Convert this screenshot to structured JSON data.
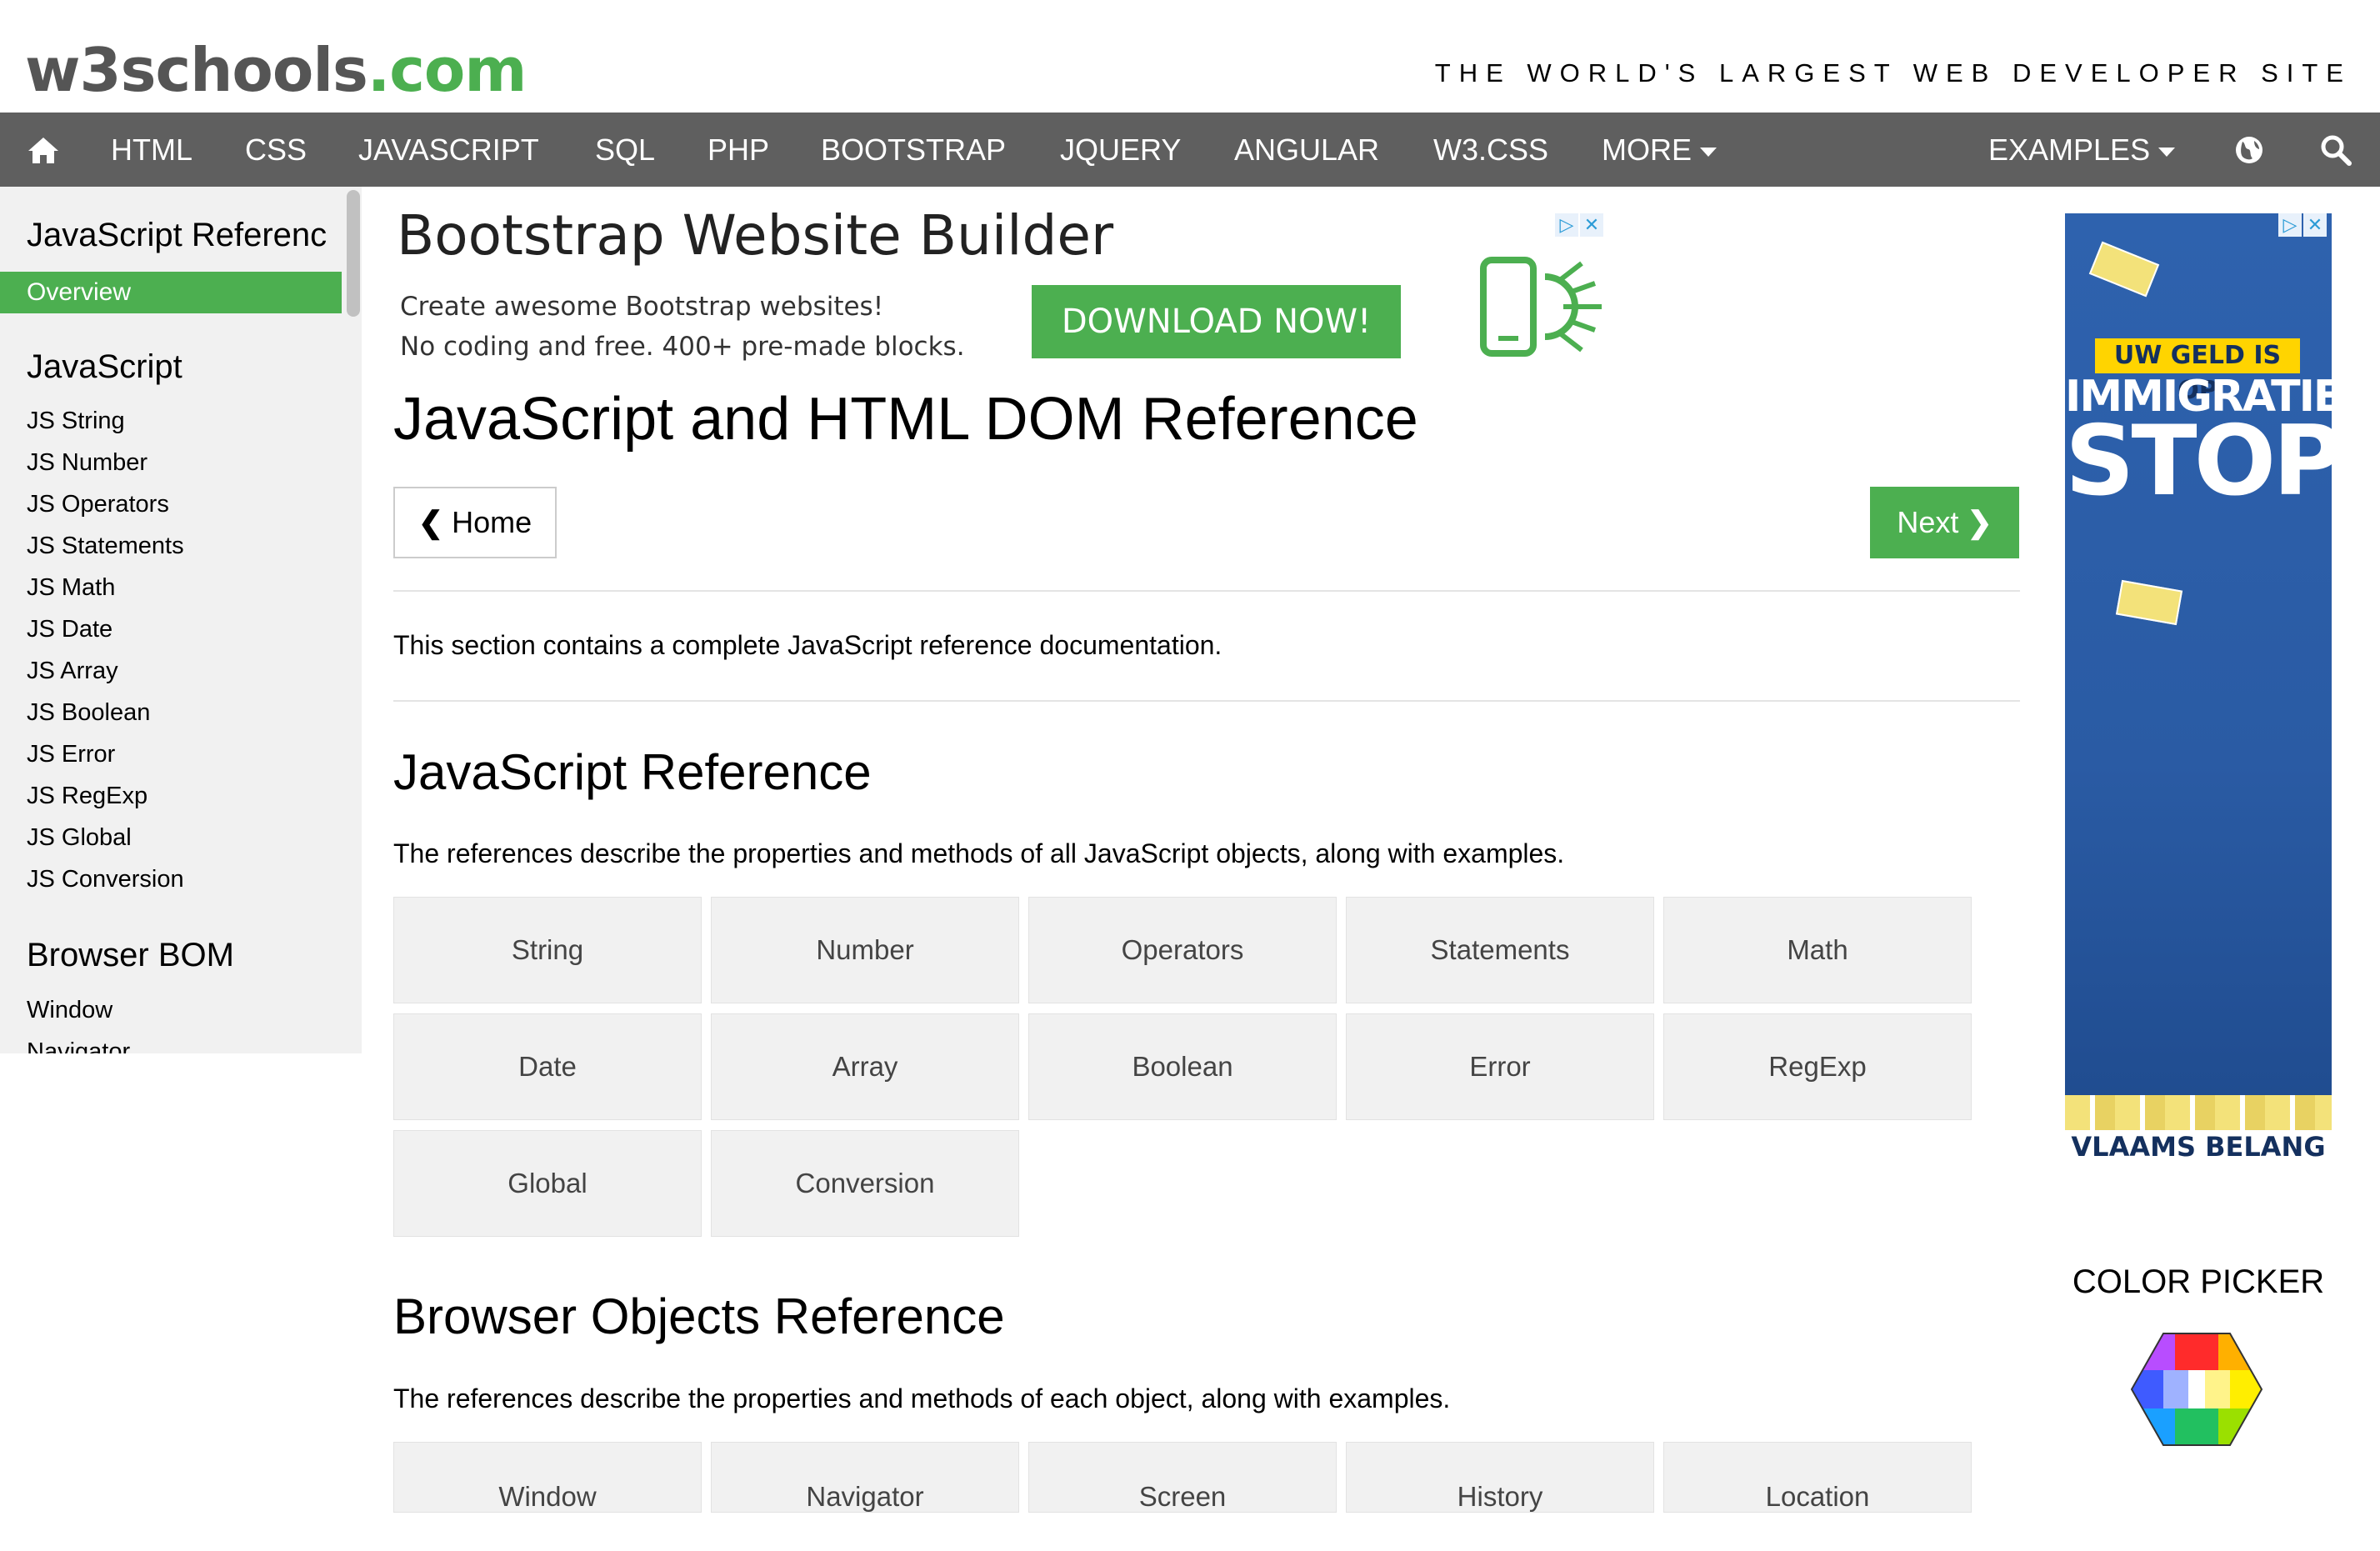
{
  "header": {
    "logo_main": "w3schools",
    "logo_suffix": ".com",
    "tagline": "THE WORLD'S LARGEST WEB DEVELOPER SITE"
  },
  "nav": {
    "home_icon": "home-icon",
    "items": [
      "HTML",
      "CSS",
      "JAVASCRIPT",
      "SQL",
      "PHP",
      "BOOTSTRAP",
      "JQUERY",
      "ANGULAR",
      "W3.CSS",
      "MORE"
    ],
    "examples": "EXAMPLES",
    "globe_icon": "globe-icon",
    "search_icon": "search-icon"
  },
  "sidebar": {
    "title": "JavaScript Referenc",
    "active": "Overview",
    "sections": [
      {
        "heading": "JavaScript",
        "links": [
          "JS String",
          "JS Number",
          "JS Operators",
          "JS Statements",
          "JS Math",
          "JS Date",
          "JS Array",
          "JS Boolean",
          "JS Error",
          "JS RegExp",
          "JS Global",
          "JS Conversion"
        ]
      },
      {
        "heading": "Browser BOM",
        "links": [
          "Window",
          "Navigator"
        ]
      }
    ]
  },
  "ad_top": {
    "title": "Bootstrap Website Builder",
    "line1": "Create awesome Bootstrap websites!",
    "line2": "No coding and free. 400+ pre-made blocks.",
    "button": "DOWNLOAD NOW!"
  },
  "main": {
    "title": "JavaScript and HTML DOM Reference",
    "home_button": "Home",
    "next_button": "Next",
    "intro": "This section contains a complete JavaScript reference documentation.",
    "sections": [
      {
        "heading": "JavaScript Reference",
        "description": "The references describe the properties and methods of all JavaScript objects, along with examples.",
        "tiles": [
          "String",
          "Number",
          "Operators",
          "Statements",
          "Math",
          "Date",
          "Array",
          "Boolean",
          "Error",
          "RegExp",
          "Global",
          "Conversion"
        ]
      },
      {
        "heading": "Browser Objects Reference",
        "description": "The references describe the properties and methods of each object, along with examples.",
        "tiles": [
          "Window",
          "Navigator",
          "Screen",
          "History",
          "Location"
        ]
      }
    ]
  },
  "ad_right": {
    "banner": "UW GELD IS OP",
    "line1": "IMMIGRATIE",
    "line2": "STOP",
    "footer": "VLAAMS BELANG"
  },
  "color_picker": {
    "title": "COLOR PICKER"
  },
  "colors": {
    "brand_green": "#4caf50",
    "nav_bg": "#5f5f5f",
    "sidebar_bg": "#f1f1f1"
  }
}
